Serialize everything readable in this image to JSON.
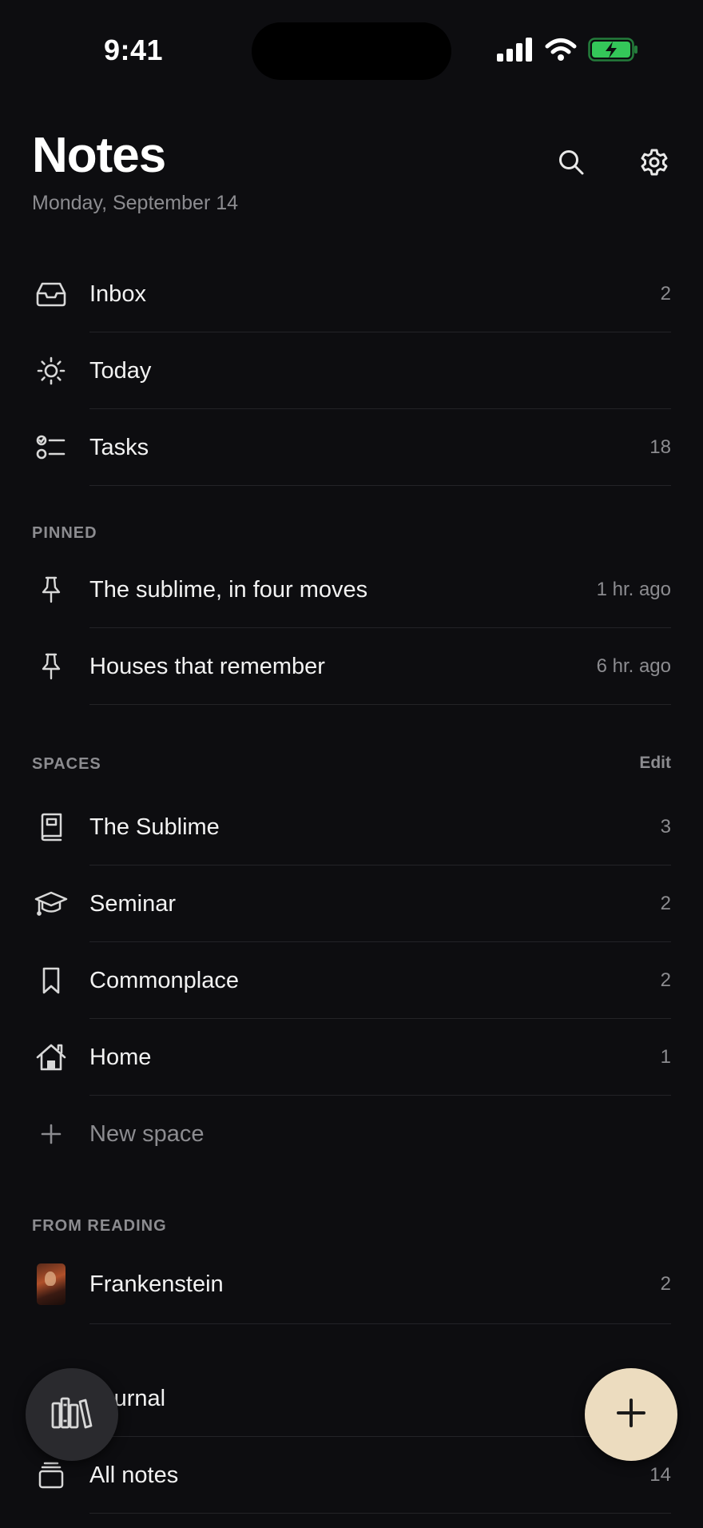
{
  "status": {
    "time": "9:41",
    "battery_color": "#34c759"
  },
  "header": {
    "title": "Notes",
    "date": "Monday, September 14",
    "icons": [
      "search-icon",
      "gear-icon"
    ]
  },
  "nav": [
    {
      "label": "Inbox",
      "count": "2",
      "icon": "inbox-icon"
    },
    {
      "label": "Today",
      "count": "",
      "icon": "sun-icon"
    },
    {
      "label": "Tasks",
      "count": "18",
      "icon": "checklist-icon"
    }
  ],
  "pinned": {
    "title": "PINNED",
    "items": [
      {
        "label": "The sublime, in four moves",
        "time": "1 hr. ago",
        "icon": "pin-icon"
      },
      {
        "label": "Houses that remember",
        "time": "6 hr. ago",
        "icon": "pin-icon"
      }
    ]
  },
  "spaces": {
    "title": "SPACES",
    "action": "Edit",
    "items": [
      {
        "label": "The Sublime",
        "count": "3",
        "icon": "book-icon"
      },
      {
        "label": "Seminar",
        "count": "2",
        "icon": "graduation-cap-icon"
      },
      {
        "label": "Commonplace",
        "count": "2",
        "icon": "bookmark-icon"
      },
      {
        "label": "Home",
        "count": "1",
        "icon": "house-icon"
      }
    ],
    "new_label": "New space"
  },
  "from_reading": {
    "title": "FROM READING",
    "items": [
      {
        "label": "Frankenstein",
        "count": "2",
        "icon": "book-cover-thumbnail"
      }
    ]
  },
  "bottom": [
    {
      "label": "Journal",
      "count": "",
      "icon": "journal-icon"
    },
    {
      "label": "All notes",
      "count": "14",
      "icon": "stack-icon"
    }
  ],
  "fabs": {
    "library_icon": "library-icon",
    "add_icon": "plus-icon",
    "add_color": "#ecdcbf"
  }
}
